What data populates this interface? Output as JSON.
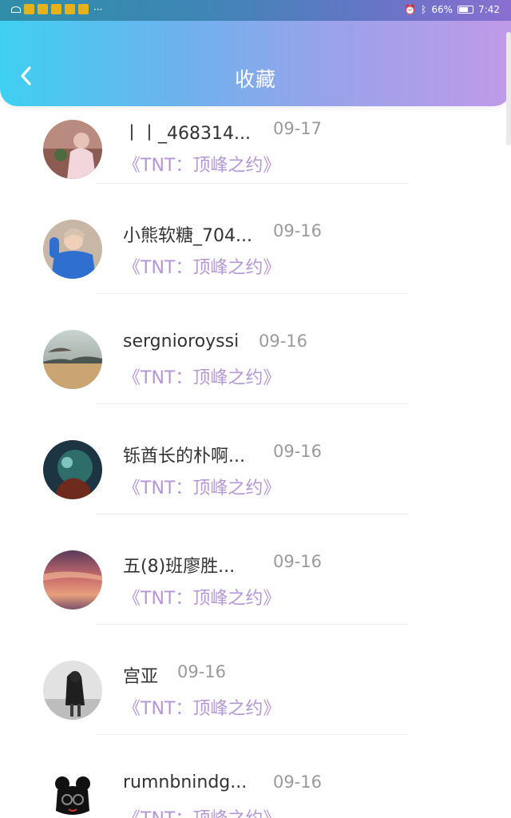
{
  "status_bar": {
    "battery": "66%",
    "time": "7:42",
    "dots": "···"
  },
  "header": {
    "title": "收藏",
    "back_icon": "chevron-left-icon"
  },
  "items": [
    {
      "name": "丨丨_468314...",
      "date": "09-17",
      "book": "《TNT：顶峰之约》",
      "avatar_colors": [
        "#c58a8c",
        "#d9a3a6",
        "#6b4a4a"
      ]
    },
    {
      "name": "小熊软糖_704...",
      "date": "09-16",
      "book": "《TNT：顶峰之约》",
      "avatar_colors": [
        "#3b78c9",
        "#d9b9a0",
        "#f0c8a8"
      ]
    },
    {
      "name": "sergnioroyssi",
      "date": "09-16",
      "book": "《TNT：顶峰之约》",
      "avatar_colors": [
        "#9ea8a8",
        "#5e6a66",
        "#d2b07a"
      ]
    },
    {
      "name": "铄酋长的朴啊...",
      "date": "09-16",
      "book": "《TNT：顶峰之约》",
      "avatar_colors": [
        "#1f3b4c",
        "#3b7a78",
        "#7a3020"
      ]
    },
    {
      "name": "五(8)班廖胜...",
      "date": "09-16",
      "book": "《TNT：顶峰之约》",
      "avatar_colors": [
        "#6a3b52",
        "#c5676a",
        "#e9a27f"
      ]
    },
    {
      "name": "宫亚",
      "date": "09-16",
      "book": "《TNT：顶峰之约》",
      "avatar_colors": [
        "#d8d8d8",
        "#262626",
        "#b0b0b0"
      ]
    },
    {
      "name": "rumnbnindg...",
      "date": "09-16",
      "book": "《TNT：顶峰之约》",
      "avatar_colors": [
        "#ffffff",
        "#111111",
        "#d93030"
      ]
    }
  ]
}
